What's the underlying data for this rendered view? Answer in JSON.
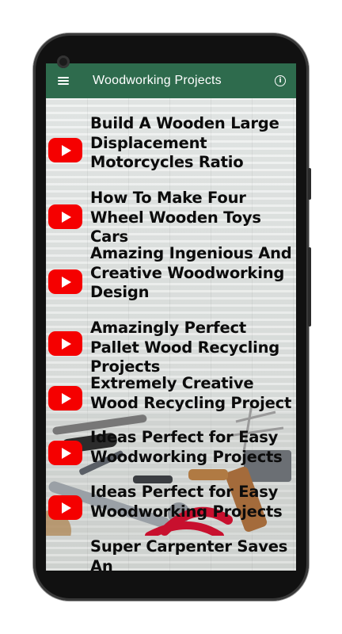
{
  "app": {
    "title": "Woodworking Projects"
  },
  "videos": [
    {
      "title": "Build A Wooden Large Displacement Motorcycles Ratio"
    },
    {
      "title": "How To Make Four Wheel Wooden Toys Cars"
    },
    {
      "title": "Amazing Ingenious And Creative Woodworking Design"
    },
    {
      "title": "Amazingly Perfect Pallet Wood Recycling Projects"
    },
    {
      "title": "Extremely Creative Wood Recycling Project"
    },
    {
      "title": "Ideas Perfect for Easy Woodworking Projects"
    },
    {
      "title": "Ideas Perfect for Easy Woodworking Projects"
    },
    {
      "title": "Super Carpenter Saves An"
    }
  ],
  "icons": {
    "menu": "hamburger-menu-icon",
    "info": "info-icon",
    "play": "youtube-play-icon"
  },
  "colors": {
    "appbar": "#2e6b4d",
    "play_button": "#f50000",
    "title_text": "#0c0c0c"
  }
}
